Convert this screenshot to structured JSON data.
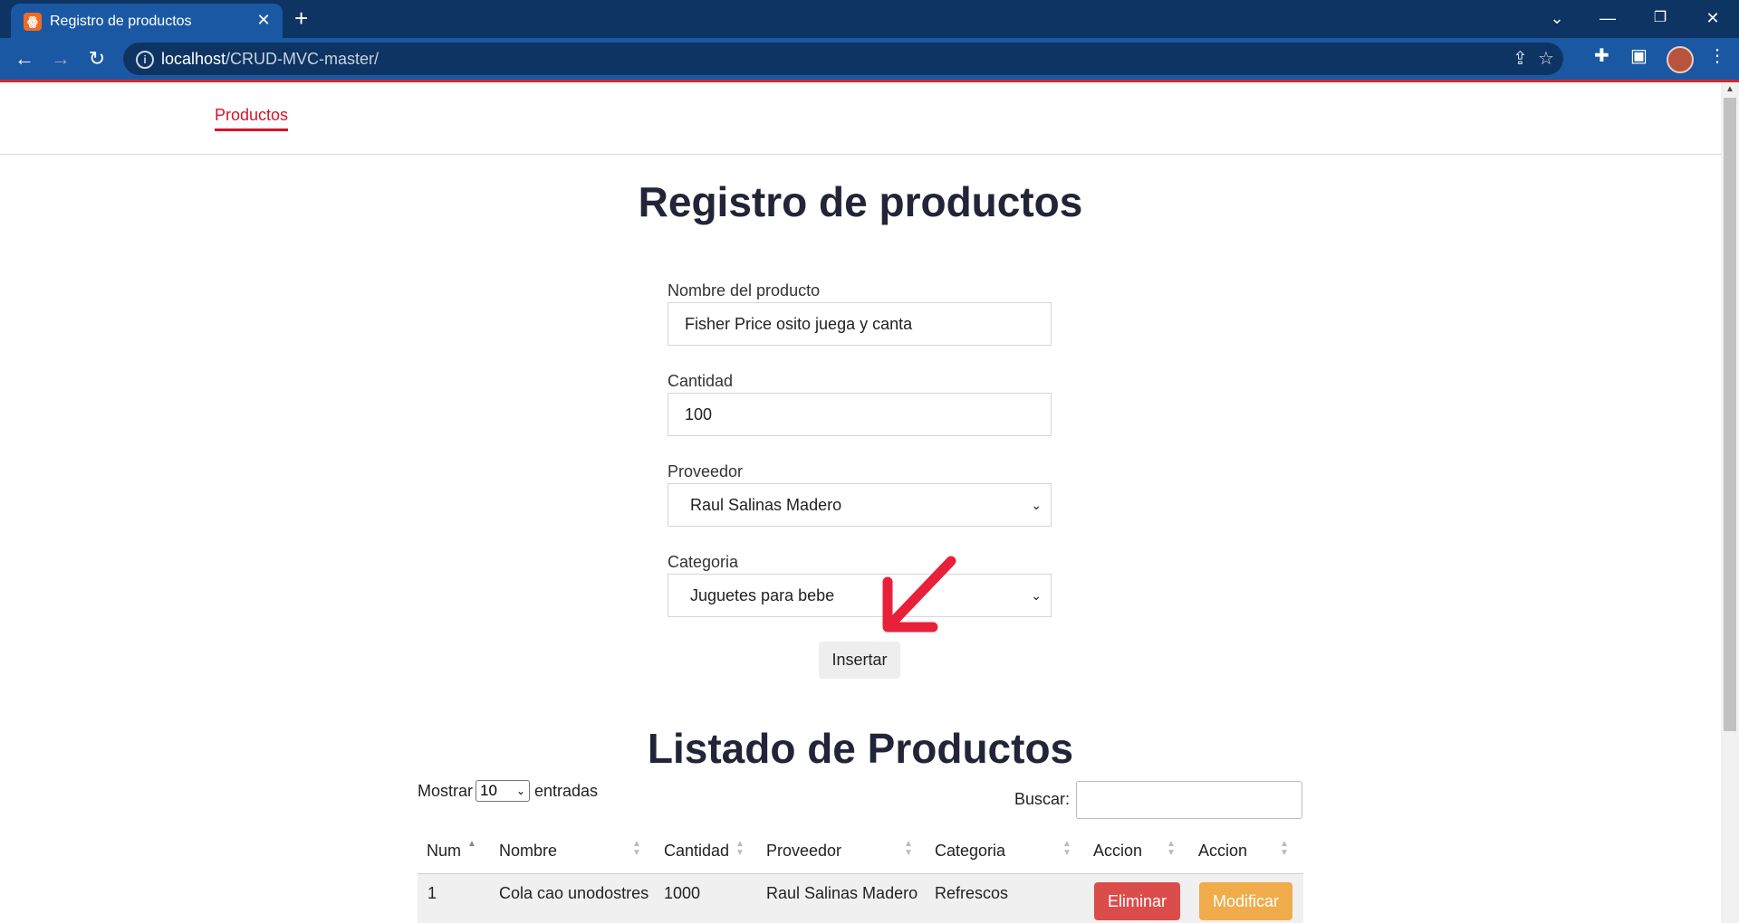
{
  "browser": {
    "tab_title": "Registro de productos",
    "favicon_glyph": "ꙮ",
    "url_host": "localhost",
    "url_path": "/CRUD-MVC-master/",
    "icons": [
      "back-icon",
      "forward-icon",
      "reload-icon",
      "info-icon",
      "share-icon",
      "star-icon",
      "extensions-icon",
      "sidepanel-icon",
      "avatar",
      "menu-icon",
      "tab-search-icon",
      "minimize-icon",
      "restore-icon",
      "close-icon",
      "new-tab-icon"
    ]
  },
  "nav": {
    "link": "Productos"
  },
  "form": {
    "title": "Registro de productos",
    "name_label": "Nombre del producto",
    "name_value": "Fisher Price osito juega y canta",
    "qty_label": "Cantidad",
    "qty_value": "100",
    "supplier_label": "Proveedor",
    "supplier_value": "Raul Salinas Madero",
    "category_label": "Categoria",
    "category_value": "Juguetes para bebe",
    "submit": "Insertar"
  },
  "list": {
    "title": "Listado de Productos",
    "show_label": "Mostrar",
    "show_value": "10",
    "entries_label": "entradas",
    "search_label": "Buscar:",
    "search_value": "",
    "columns": [
      "Num",
      "Nombre",
      "Cantidad",
      "Proveedor",
      "Categoria",
      "Accion",
      "Accion"
    ],
    "rows": [
      {
        "num": "1",
        "nombre": "Cola cao unodostres",
        "cantidad": "1000",
        "proveedor": "Raul Salinas Madero",
        "categoria": "Refrescos",
        "delete": "Eliminar",
        "edit": "Modificar"
      }
    ]
  },
  "colors": {
    "accent": "#d0142c",
    "danger": "#db4d4a",
    "warning": "#f0ac4b",
    "chrome": "#1b58a3",
    "annotation_arrow": "#e8203a"
  }
}
